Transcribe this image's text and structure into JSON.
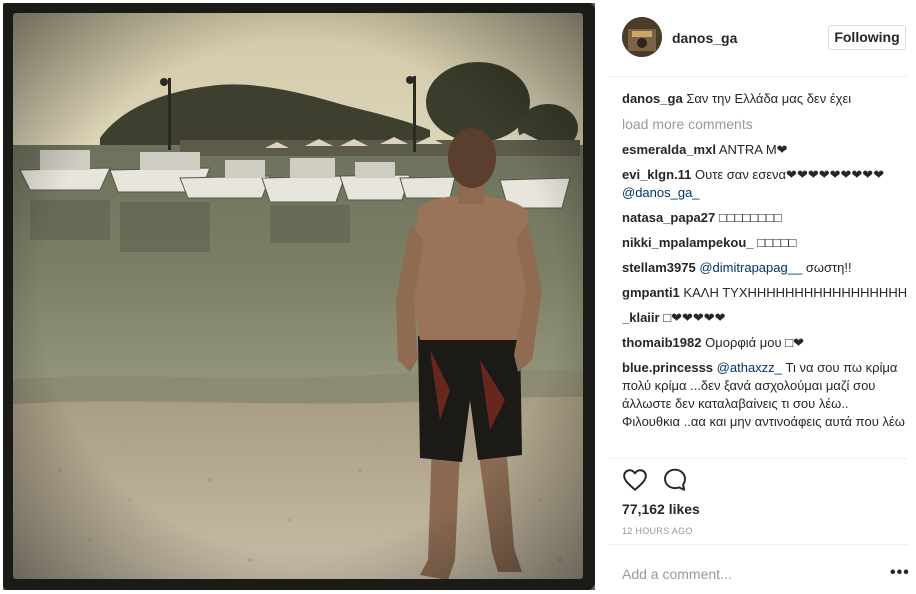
{
  "post": {
    "username": "danos_ga",
    "follow_label": "Following",
    "caption_user": "danos_ga",
    "caption_text": "Σαν την Ελλάδα μας δεν έχει",
    "load_more": "load more comments",
    "comments": [
      {
        "user": "esmeralda_mxl",
        "text": "ANTRA M❤"
      },
      {
        "user": "evi_klgn.11",
        "text": "Ουτε σαν εσενα❤❤❤❤❤❤❤❤❤",
        "mention": "@danos_ga_"
      },
      {
        "user": "natasa_papa27",
        "text": "□□□□□□□□"
      },
      {
        "user": "nikki_mpalampekou_",
        "text": "□□□□□"
      },
      {
        "user": "stellam3975",
        "mention": "@dimitrapapag__",
        "text": "σωστη!!"
      },
      {
        "user": "gmpanti1",
        "text": "ΚΑΛΗ ΤΥΧΗΗΗΗΗΗΗΗΗΗΗΗΗΗΗΗΗ"
      },
      {
        "user": "_klaiir",
        "text": "□❤❤❤❤❤"
      },
      {
        "user": "thomaib1982",
        "text": "Ομορφιά μου □❤"
      },
      {
        "user": "blue.princesss",
        "mention": "@athaxzz_",
        "text": "Τι να σου πω κρίμα πολύ κρίμα ...δεν ξανά ασχολούμαι μαζί σου άλλωστε δεν καταλαβαίνεις τι σου λέω.. Φιλουθκια ..αα και μην αντινοάφεις αυτά που λέω"
      }
    ],
    "likes": "77,162 likes",
    "time": "12 HOURS AGO",
    "add_comment_placeholder": "Add a comment...",
    "more_label": "•••"
  },
  "icons": {
    "like": "heart-outline-icon",
    "comment": "speech-bubble-icon",
    "more": "more-options-icon"
  },
  "colors": {
    "text": "#262626",
    "mention": "#003569",
    "muted": "#999999",
    "border": "#efefef"
  }
}
